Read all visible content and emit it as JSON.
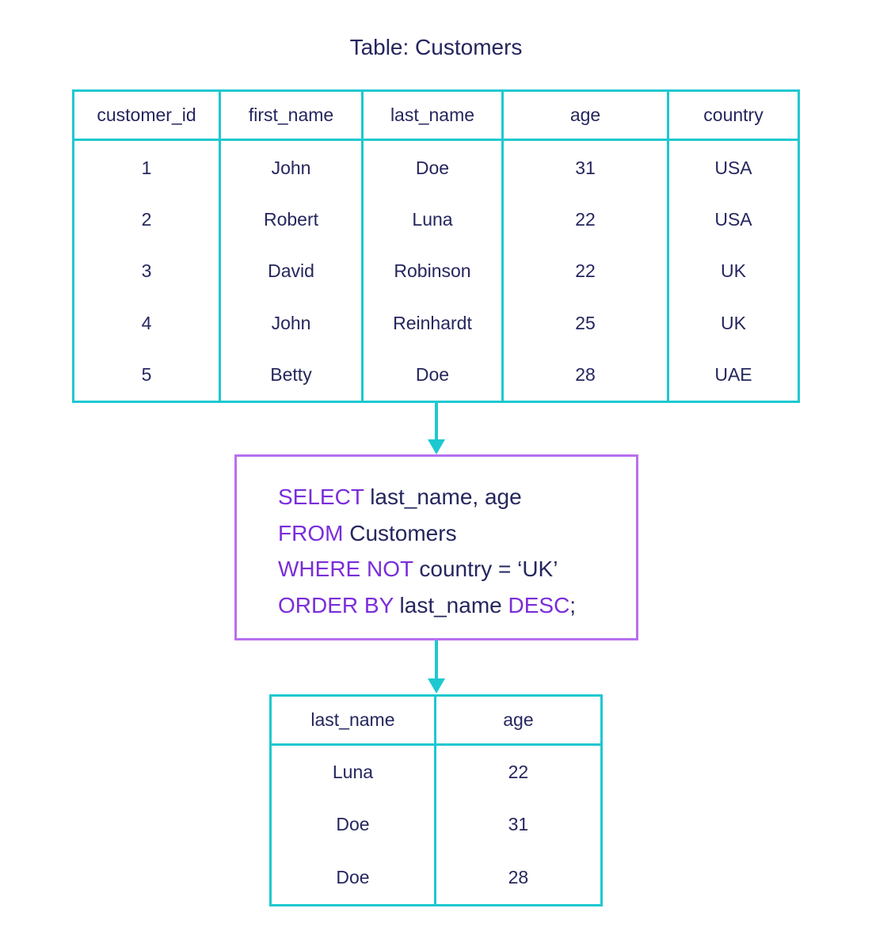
{
  "title": "Table: Customers",
  "colors": {
    "table_border": "#1dc8d0",
    "query_border": "#b86ff0",
    "keyword": "#7b2ddb",
    "text": "#25265e",
    "arrow": "#1dc8d0"
  },
  "customers": {
    "columns": [
      "customer_id",
      "first_name",
      "last_name",
      "age",
      "country"
    ],
    "rows": [
      [
        "1",
        "John",
        "Doe",
        "31",
        "USA"
      ],
      [
        "2",
        "Robert",
        "Luna",
        "22",
        "USA"
      ],
      [
        "3",
        "David",
        "Robinson",
        "22",
        "UK"
      ],
      [
        "4",
        "John",
        "Reinhardt",
        "25",
        "UK"
      ],
      [
        "5",
        "Betty",
        "Doe",
        "28",
        "UAE"
      ]
    ]
  },
  "query": {
    "lines": [
      [
        {
          "t": "SELECT",
          "kw": true
        },
        {
          "t": " last_name, age",
          "kw": false
        }
      ],
      [
        {
          "t": "FROM",
          "kw": true
        },
        {
          "t": " Customers",
          "kw": false
        }
      ],
      [
        {
          "t": "WHERE NOT",
          "kw": true
        },
        {
          "t": " country = ‘UK’",
          "kw": false
        }
      ],
      [
        {
          "t": "ORDER BY",
          "kw": true
        },
        {
          "t": " last_name ",
          "kw": false
        },
        {
          "t": "DESC",
          "kw": true
        },
        {
          "t": ";",
          "kw": false
        }
      ]
    ]
  },
  "result": {
    "columns": [
      "last_name",
      "age"
    ],
    "rows": [
      [
        "Luna",
        "22"
      ],
      [
        "Doe",
        "31"
      ],
      [
        "Doe",
        "28"
      ]
    ]
  }
}
